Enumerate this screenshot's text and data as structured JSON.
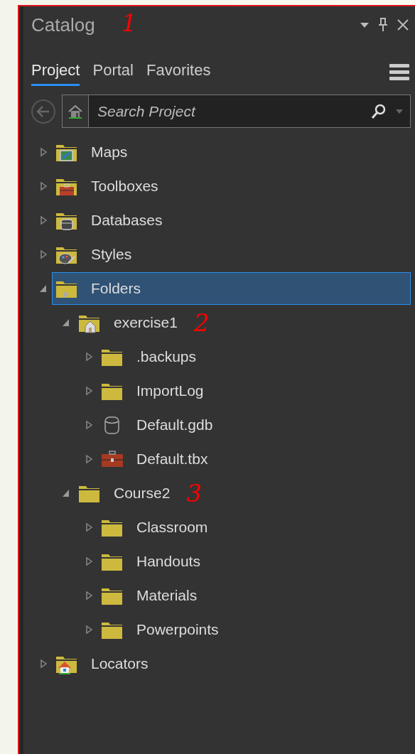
{
  "pane": {
    "title": "Catalog",
    "title_annotation": "1"
  },
  "tabs": [
    {
      "label": "Project",
      "selected": true
    },
    {
      "label": "Portal",
      "selected": false
    },
    {
      "label": "Favorites",
      "selected": false
    }
  ],
  "search": {
    "placeholder": "Search Project"
  },
  "tree": [
    {
      "label": "Maps",
      "kind": "maps",
      "expanded": false,
      "selected": false
    },
    {
      "label": "Toolboxes",
      "kind": "toolboxes",
      "expanded": false,
      "selected": false
    },
    {
      "label": "Databases",
      "kind": "databases",
      "expanded": false,
      "selected": false
    },
    {
      "label": "Styles",
      "kind": "styles",
      "expanded": false,
      "selected": false
    },
    {
      "label": "Folders",
      "kind": "folders",
      "expanded": true,
      "selected": true,
      "children": [
        {
          "label": "exercise1",
          "kind": "home-folder",
          "expanded": true,
          "selected": false,
          "annotation": "2",
          "children": [
            {
              "label": ".backups",
              "kind": "folder",
              "expanded": false,
              "selected": false
            },
            {
              "label": "ImportLog",
              "kind": "folder",
              "expanded": false,
              "selected": false
            },
            {
              "label": "Default.gdb",
              "kind": "gdb",
              "expanded": false,
              "selected": false
            },
            {
              "label": "Default.tbx",
              "kind": "tbx",
              "expanded": false,
              "selected": false
            }
          ]
        },
        {
          "label": "Course2",
          "kind": "folder",
          "expanded": true,
          "selected": false,
          "annotation": "3",
          "children": [
            {
              "label": "Classroom",
              "kind": "folder",
              "expanded": false,
              "selected": false
            },
            {
              "label": "Handouts",
              "kind": "folder",
              "expanded": false,
              "selected": false
            },
            {
              "label": "Materials",
              "kind": "folder",
              "expanded": false,
              "selected": false
            },
            {
              "label": "Powerpoints",
              "kind": "folder",
              "expanded": false,
              "selected": false
            }
          ]
        }
      ]
    },
    {
      "label": "Locators",
      "kind": "locators",
      "expanded": false,
      "selected": false
    }
  ]
}
